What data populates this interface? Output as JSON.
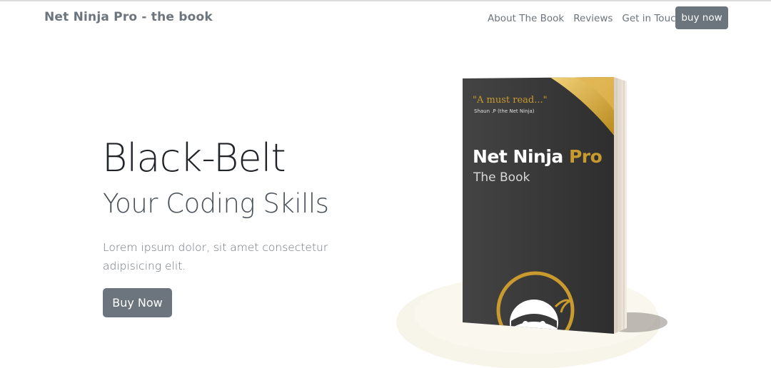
{
  "navbar": {
    "brand": "Net Ninja Pro - the book",
    "links": [
      "About The Book",
      "Reviews",
      "Get in Touch"
    ],
    "cta": "buy now"
  },
  "hero": {
    "title": "Black-Belt",
    "subtitle": "Your Coding Skills",
    "lead": "Lorem ipsum dolor, sit amet consectetur adipisicing elit.",
    "button": "Buy Now"
  },
  "book": {
    "quote": "\"A must read...\"",
    "quote_author": "Shaun .P (the Net Ninja)",
    "title_main": "Net Ninja",
    "title_accent": "Pro",
    "subtitle": "The Book"
  },
  "colors": {
    "secondary": "#6c757d",
    "book_cover": "#3a3a3a",
    "gold": "#c99a2e",
    "platform": "#f7f4ea"
  },
  "icons": {
    "ninja_logo": "ninja-head-icon"
  }
}
